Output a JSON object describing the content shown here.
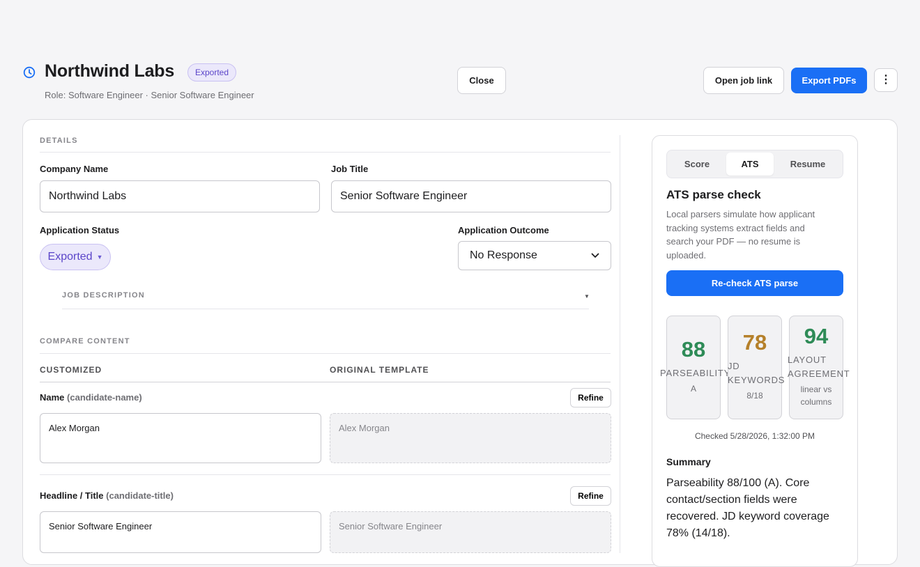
{
  "header": {
    "title": "Northwind Labs",
    "status_badge": "Exported",
    "subtitle": "Role: Software Engineer · Senior Software Engineer",
    "close_label": "Close",
    "open_job_label": "Open job link",
    "export_label": "Export PDFs",
    "more_icon": "⋮"
  },
  "details": {
    "section_label": "DETAILS",
    "company_label": "Company Name",
    "company_value": "Northwind Labs",
    "job_title_label": "Job Title",
    "job_title_value": "Senior Software Engineer",
    "status_label": "Application Status",
    "status_value": "Exported",
    "outcome_label": "Application Outcome",
    "outcome_value": "No Response",
    "job_description_label": "JOB DESCRIPTION"
  },
  "compare": {
    "section_label": "COMPARE CONTENT",
    "col_customized": "CUSTOMIZED",
    "col_original": "ORIGINAL TEMPLATE",
    "rows": [
      {
        "label": "Name",
        "key": "(candidate-name)",
        "refine": "Refine",
        "customized": "Alex Morgan",
        "original": "Alex Morgan"
      },
      {
        "label": "Headline / Title",
        "key": "(candidate-title)",
        "refine": "Refine",
        "customized": "Senior Software Engineer",
        "original": "Senior Software Engineer"
      }
    ]
  },
  "panel": {
    "tabs": [
      "Score",
      "ATS",
      "Resume"
    ],
    "active_tab": "ATS",
    "title": "ATS parse check",
    "description": "Local parsers simulate how applicant tracking systems extract fields and search your PDF — no resume is uploaded.",
    "recheck_label": "Re-check ATS parse",
    "scores": [
      {
        "value": "88",
        "label": "PARSEABILITY",
        "sub": "A",
        "color": "#2e8b57"
      },
      {
        "value": "78",
        "label": "JD KEYWORDS",
        "sub": "8/18",
        "color": "#b5802a"
      },
      {
        "value": "94",
        "label": "LAYOUT AGREEMENT",
        "sub": "linear vs columns",
        "color": "#2e8b57"
      }
    ],
    "checked": "Checked 5/28/2026, 1:32:00 PM",
    "summary_heading": "Summary",
    "summary_text": "Parseability 88/100 (A). Core contact/section fields were recovered. JD keyword coverage 78% (14/18)."
  }
}
